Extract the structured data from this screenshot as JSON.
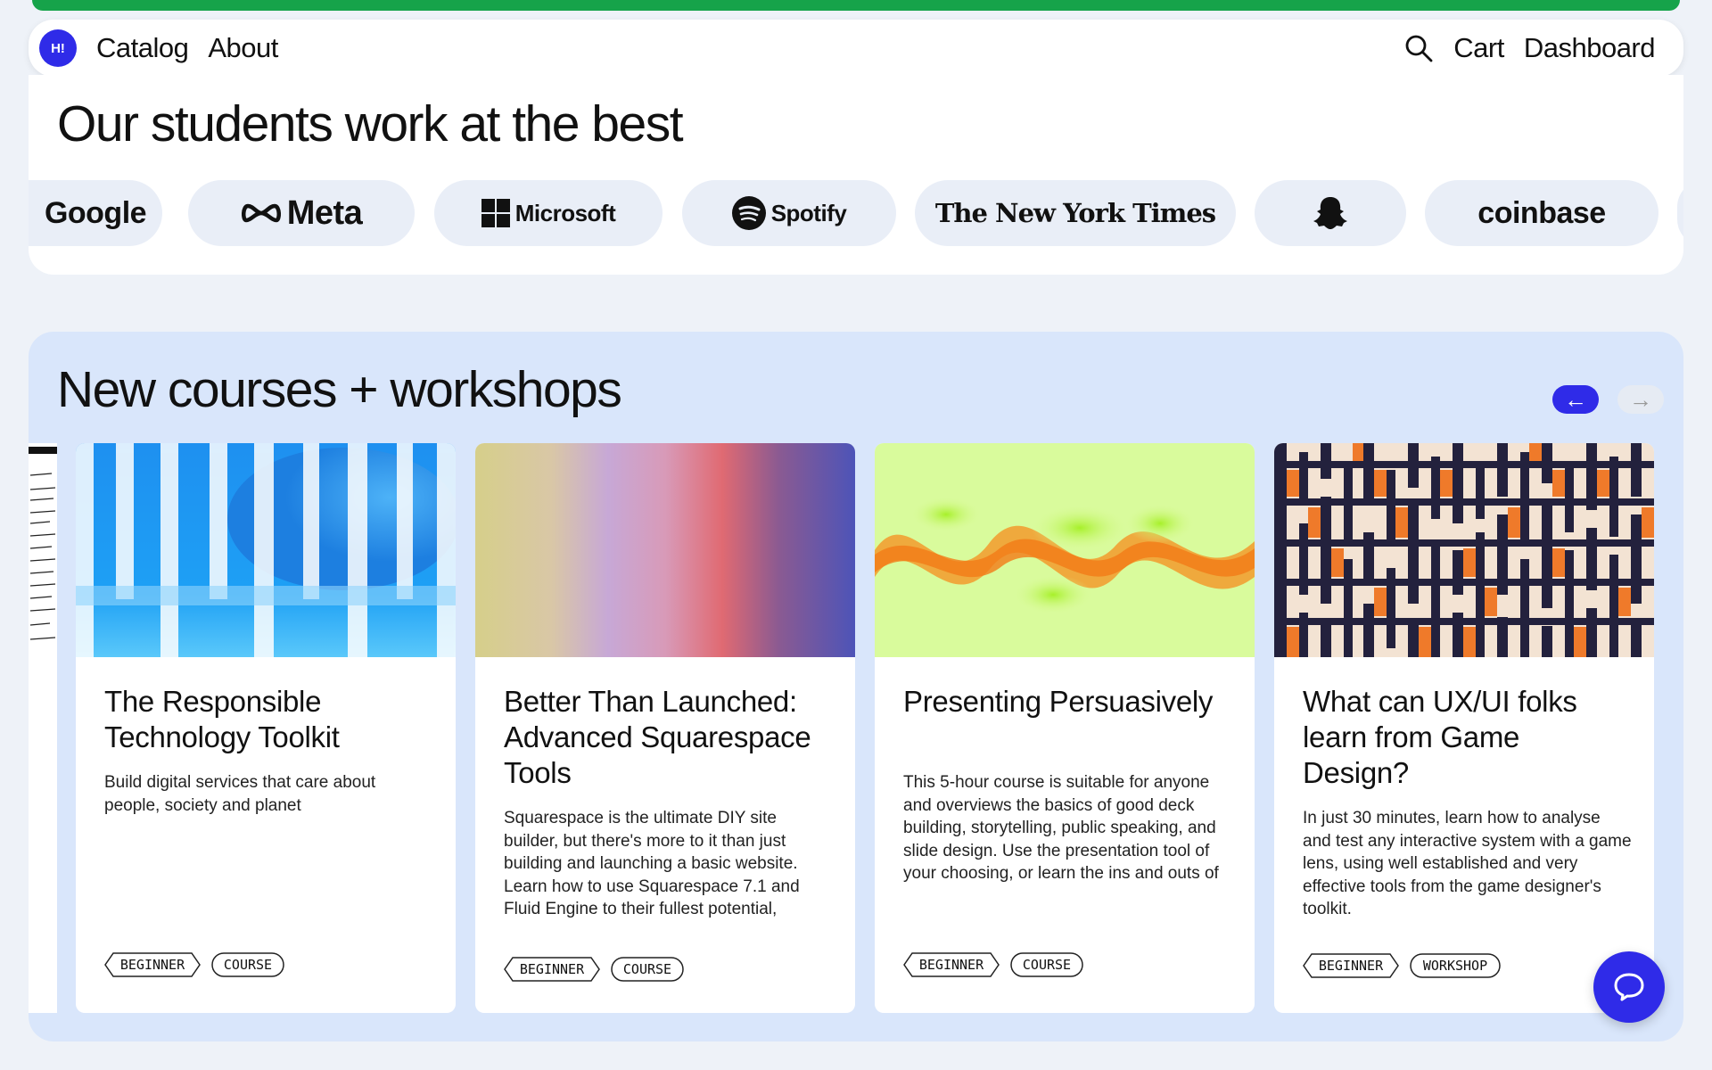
{
  "nav": {
    "logo_text": "H!",
    "catalog": "Catalog",
    "about": "About",
    "cart": "Cart",
    "dashboard": "Dashboard"
  },
  "students": {
    "heading": "Our students work at the best",
    "companies": [
      "Google",
      "Meta",
      "Microsoft",
      "Spotify",
      "The New York Times",
      "Snapchat",
      "coinbase"
    ]
  },
  "courses": {
    "heading": "New courses + workshops",
    "prev_label": "←",
    "next_label": "→",
    "items": [
      {
        "title": "The Responsible Technology Toolkit",
        "description": "Build digital services that care about people, society and planet",
        "tags": [
          "BEGINNER",
          "COURSE"
        ]
      },
      {
        "title": "Better Than Launched: Advanced Squarespace Tools",
        "description": "Squarespace is the ultimate DIY site builder, but there's more to it than just building and launching a basic website. Learn how to use Squarespace 7.1 and Fluid Engine to their fullest potential,",
        "tags": [
          "BEGINNER",
          "COURSE"
        ]
      },
      {
        "title": "Presenting Persuasively",
        "description": "This 5-hour course is suitable for anyone and overviews the basics of good deck building, storytelling, public speaking, and slide design. Use the presentation tool of your choosing, or learn the ins and outs of",
        "tags": [
          "BEGINNER",
          "COURSE"
        ]
      },
      {
        "title": "What can UX/UI folks learn from Game Design?",
        "description": "In just 30 minutes, learn how to analyse and test any interactive system with a game lens, using well established and very effective tools from the game designer's toolkit.",
        "tags": [
          "BEGINNER",
          "WORKSHOP"
        ]
      }
    ]
  },
  "colors": {
    "accent_green": "#16a34a",
    "brand_blue": "#2f2be8",
    "section_bg": "#d9e6fb"
  }
}
